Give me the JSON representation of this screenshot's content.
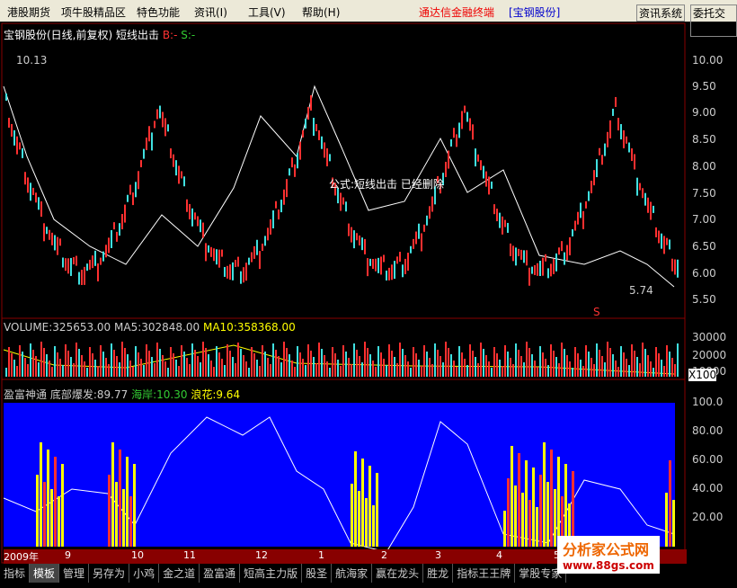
{
  "menu": [
    "港股期货",
    "项牛股精品区",
    "特色功能",
    "资讯(I)",
    "工具(V)",
    "帮助(H)"
  ],
  "banner": "通达信金融终端",
  "stock": "[宝钢股份]",
  "btn1": "资讯系统",
  "btn2": "委托交易",
  "kline": {
    "title": "宝钢股份(日线,前复权) 短线出击",
    "b": "B:-",
    "s": "S:-",
    "hi": "10.13",
    "lo": "5.74",
    "msg": "公式:短线出击 已经删除",
    "ticks": [
      "10.00",
      "9.50",
      "9.00",
      "8.50",
      "8.00",
      "7.50",
      "7.00",
      "6.50",
      "6.00",
      "5.50"
    ],
    "sig": "S"
  },
  "vol": {
    "v": "VOLUME:325653.00",
    "ma5": "MA5:302848.00",
    "ma10": "MA10:358368.00",
    "ticks": [
      "30000",
      "20000",
      "10000"
    ],
    "unit": "X100"
  },
  "ind": {
    "name": "盈富神通",
    "d": "底部爆发:89.77",
    "h": "海岸:10.30",
    "w": "浪花:9.64",
    "ticks": [
      "100.0",
      "80.00",
      "60.00",
      "40.00",
      "20.00"
    ]
  },
  "dates": [
    "2009年",
    "9",
    "10",
    "11",
    "12",
    "1",
    "2",
    "3",
    "4",
    "5",
    "6"
  ],
  "tabs": [
    "指标",
    "模板",
    "管理",
    "另存为",
    "小鸡",
    "金之道",
    "盈富通",
    "短高主力版",
    "股圣",
    "航海家",
    "赢在龙头",
    "胜龙",
    "指标王王牌",
    "掌股专家"
  ],
  "logo": "分析家公式网",
  "url": "www.88gs.com",
  "colors": {
    "up": "#ff3030",
    "down": "#40e0e0",
    "blue": "#0000ff",
    "yellow": "#ffff00"
  }
}
